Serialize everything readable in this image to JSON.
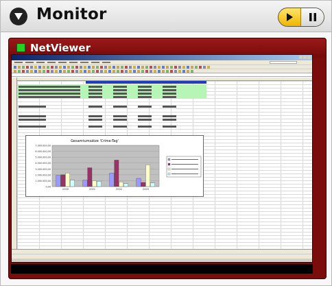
{
  "header": {
    "title": "Monitor",
    "collapse_icon": "triangle-down-icon",
    "play_icon": "play-icon",
    "pause_icon": "pause-icon",
    "accent": "#f5c400"
  },
  "panel": {
    "title": "NetViewer",
    "status_color": "#25d025",
    "frame_color": "#7a0c0c"
  },
  "spreadsheet": {
    "header_color": "#1f3fbf",
    "highlight_color": "#b7f5b7",
    "chart_title": "Gesamtumsätze 'Crime-Tag'"
  },
  "chart_data": {
    "type": "bar",
    "title": "Gesamtumsätze 'Crime-Tag'",
    "categories": [
      "2000",
      "2001",
      "2002",
      "2003"
    ],
    "ylim": [
      0,
      7000000
    ],
    "series": [
      {
        "color": "#9999ff",
        "values": [
          1900000,
          1100000,
          2300000,
          1400000
        ]
      },
      {
        "color": "#993366",
        "values": [
          2000000,
          3200000,
          4500000,
          700000
        ]
      },
      {
        "color": "#ffffcc",
        "values": [
          2300000,
          1000000,
          800000,
          3700000
        ]
      },
      {
        "color": "#ccffff",
        "values": [
          1100000,
          900000,
          500000,
          600000
        ]
      }
    ],
    "grid": true,
    "legend": "right"
  }
}
